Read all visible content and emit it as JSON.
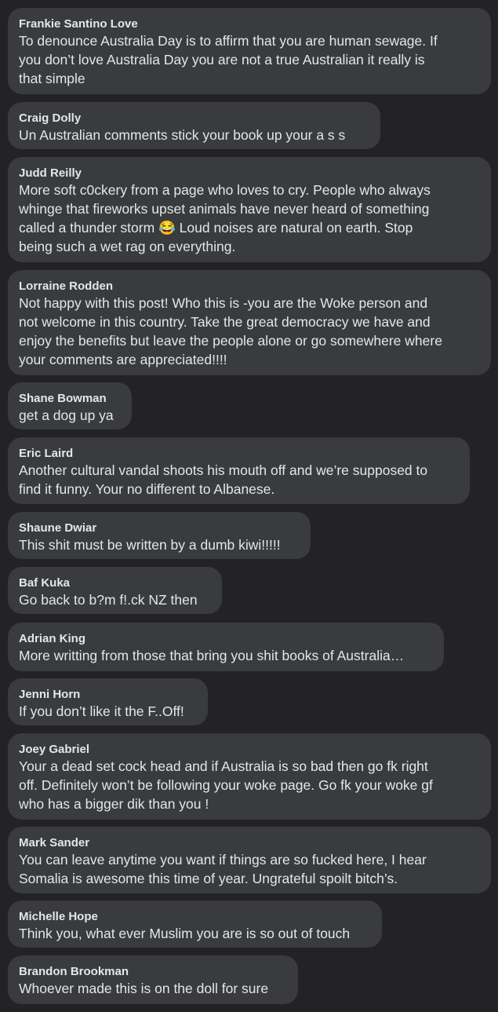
{
  "comments": [
    {
      "author": "Frankie Santino Love",
      "text": "To denounce Australia Day is to affirm that you are human sewage. If\nyou don’t love Australia Day you are not a true Australian it really is\nthat simple"
    },
    {
      "author": "Craig Dolly",
      "text": "Un Australian comments stick your book up your a s s"
    },
    {
      "author": "Judd Reilly",
      "text": "More soft c0ckery from a page who loves to cry. People who always\nwhinge that fireworks upset animals have never heard of something\ncalled a thunder storm 😂 Loud noises are natural on earth. Stop\nbeing such a wet rag on everything."
    },
    {
      "author": "Lorraine Rodden",
      "text": "Not happy with this post! Who this is -you are the Woke person and\nnot welcome in this country. Take the great democracy we have and\nenjoy the benefits but leave the people alone or go somewhere where\nyour comments are appreciated!!!!"
    },
    {
      "author": "Shane Bowman",
      "text": "get a dog up ya"
    },
    {
      "author": "Eric Laird",
      "text": "Another cultural vandal shoots his mouth off and we’re supposed to\nfind it funny. Your no different to Albanese."
    },
    {
      "author": "Shaune Dwiar",
      "text": "This shit must be written by a dumb kiwi!!!!!"
    },
    {
      "author": "Baf Kuka",
      "text": "Go back to b?m f!.ck NZ then"
    },
    {
      "author": "Adrian King",
      "text": "More writting from those that bring you shit books of Australia…"
    },
    {
      "author": "Jenni Horn",
      "text": "If you don’t like it the F..Off!"
    },
    {
      "author": "Joey Gabriel",
      "text": "Your a dead set cock head and if Australia is so bad then go fk right\noff. Definitely won’t be following your woke page. Go fk your woke gf\nwho has a bigger dik than you !"
    },
    {
      "author": "Mark Sander",
      "text": "You can leave anytime you want if things are so fucked here, I hear\nSomalia is awesome this time of year. Ungrateful spoilt bitch’s."
    },
    {
      "author": "Michelle Hope",
      "text": "Think you, what ever Muslim you are is so out of touch"
    },
    {
      "author": "Brandon Brookman",
      "text": "Whoever made this is on the doll for sure"
    }
  ]
}
